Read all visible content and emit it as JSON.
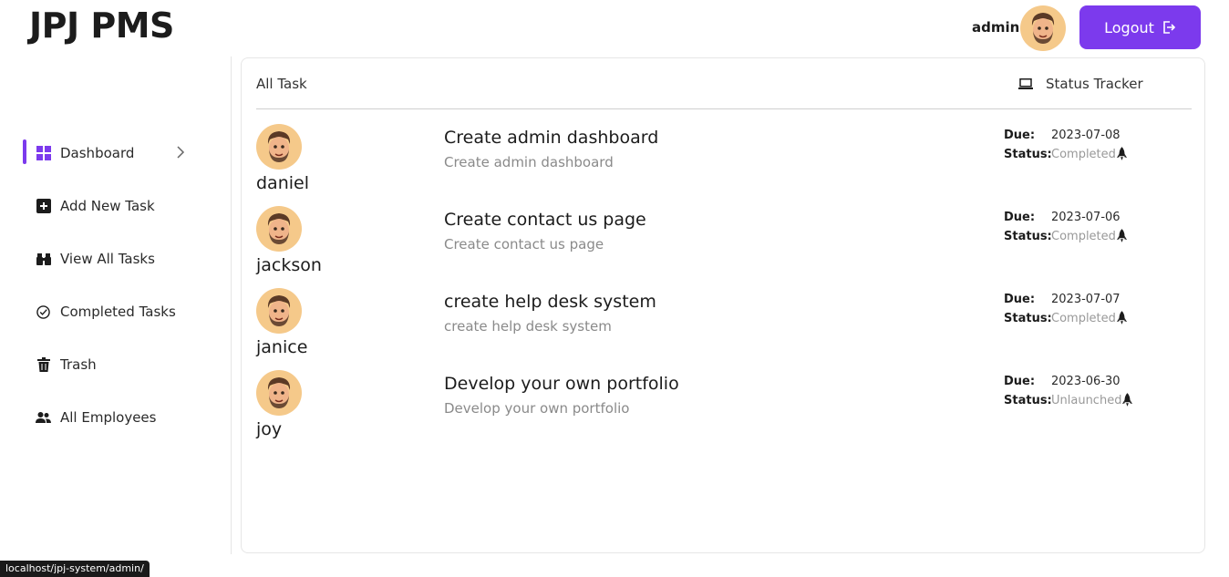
{
  "brand": "JPJ PMS",
  "user": {
    "name": "admin"
  },
  "header": {
    "logout_label": "Logout"
  },
  "sidebar": {
    "items": [
      {
        "label": "Dashboard",
        "icon": "grid-icon",
        "active": true
      },
      {
        "label": "Add New Task",
        "icon": "plus-square-icon"
      },
      {
        "label": "View All Tasks",
        "icon": "binoculars-icon"
      },
      {
        "label": "Completed Tasks",
        "icon": "check-circle-icon"
      },
      {
        "label": "Trash",
        "icon": "trash-icon"
      },
      {
        "label": "All Employees",
        "icon": "people-icon"
      }
    ]
  },
  "panel": {
    "title": "All Task",
    "tracker_label": "Status Tracker"
  },
  "labels": {
    "due": "Due:",
    "status": "Status:"
  },
  "tasks": [
    {
      "employee": "daniel",
      "title": "Create admin dashboard",
      "description": "Create admin dashboard",
      "due": "2023-07-08",
      "status": "Completed"
    },
    {
      "employee": "jackson",
      "title": "Create contact us page",
      "description": "Create contact us page",
      "due": "2023-07-06",
      "status": "Completed"
    },
    {
      "employee": "janice",
      "title": "create help desk system",
      "description": "create help desk system",
      "due": "2023-07-07",
      "status": "Completed"
    },
    {
      "employee": "joy",
      "title": "Develop your own portfolio",
      "description": "Develop your own portfolio",
      "due": "2023-06-30",
      "status": "Unlaunched"
    }
  ],
  "status_url": "localhost/jpj-system/admin/",
  "colors": {
    "accent": "#7c3aed"
  }
}
